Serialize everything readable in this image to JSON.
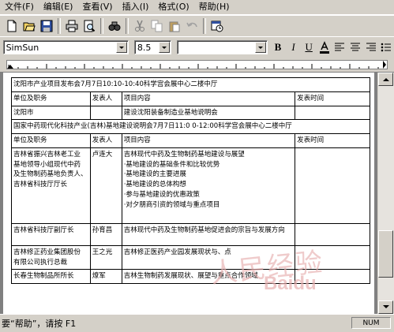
{
  "menu": [
    "文件(F)",
    "编辑(E)",
    "查看(V)",
    "插入(I)",
    "格式(O)",
    "帮助(H)"
  ],
  "toolbar_icons": [
    "new-icon",
    "open-icon",
    "save-icon",
    "print-icon",
    "print-preview-icon",
    "find-icon",
    "cut-icon",
    "copy-icon",
    "paste-icon",
    "undo-icon",
    "insert-date-icon"
  ],
  "format": {
    "font": "SimSun",
    "size": "8.5",
    "charset": "",
    "bold": "B",
    "italic": "I",
    "underline": "U",
    "color_icon": "font-color-icon",
    "align_left_icon": "align-left-icon",
    "align_center_icon": "align-center-icon",
    "align_right_icon": "align-right-icon",
    "bullets_icon": "bullets-icon"
  },
  "table": {
    "r1": "沈阳市产业项目发布会7月7日10:10-10:40科学宫会展中心二楼中厅",
    "hdr": [
      "单位及职务",
      "发表人",
      "项目内容",
      "发表时间"
    ],
    "r3": {
      "a": "沈阳市",
      "b": "",
      "c": "建设沈阳装备制造业基地说明会",
      "d": ""
    },
    "r4": "国家中药现代化科技产业(吉林)基地建设说明会7月7日11:0 0-12:00科学宫会展中心二楼中厅",
    "r6": {
      "a1": "吉林省振兴吉林老工业",
      "a2": "基地领导小组现代中药",
      "a3": "及生物制药基地负责人、吉林省科技厅厅长",
      "b": "卢连大",
      "c1": "吉林现代中药及生物制药基地建设与展望",
      "c2": "·基地建设的基础条件和比较优势",
      "c3": "·基地建设的主要进展",
      "c4": "·基地建设的总体构想",
      "c5": "·参与基地建设的优惠政策",
      "c6": "·对夕朋商引资的领域与重点项目",
      "d": ""
    },
    "r7": {
      "a": "吉林省科技厅副厅长",
      "b": "孙育昌",
      "c": "吉林现代中药及生物制药基地促进会的宗旨与发展方向",
      "d": ""
    },
    "r8": {
      "a1": "吉林修正药业集团股份",
      "a2": "有限公司执行总裁",
      "b": "王之光",
      "c": "吉林修正医药产业园发展现状与、点",
      "d": ""
    },
    "r9": {
      "a": "长春生物制品所所长",
      "b": "燎军",
      "c": "吉林生物制药发展现状、展望与重点合作领域",
      "d": ""
    }
  },
  "watermark": {
    "cn": "人民经验",
    "en": "Baidu"
  },
  "status": {
    "text": "要“帮助”，请按 F1",
    "num": "NUM"
  }
}
